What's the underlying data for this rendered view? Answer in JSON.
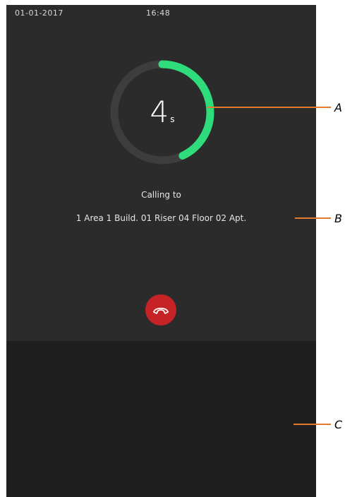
{
  "status_bar": {
    "date": "01-01-2017",
    "time": "16:48"
  },
  "call": {
    "elapsed_value": "4",
    "elapsed_unit": "s",
    "progress_fraction": 0.43,
    "calling_label": "Calling to",
    "target": "1 Area 1 Build. 01 Riser 04 Floor 02 Apt."
  },
  "hangup": {
    "icon": "phone-hangup-icon"
  },
  "callouts": {
    "a": "A",
    "b": "B",
    "c": "C"
  },
  "colors": {
    "progress_ring": "#2fdc7b",
    "ring_track": "#3d3d3d",
    "hangup": "#c62326",
    "callout_line": "#e07b2d"
  }
}
